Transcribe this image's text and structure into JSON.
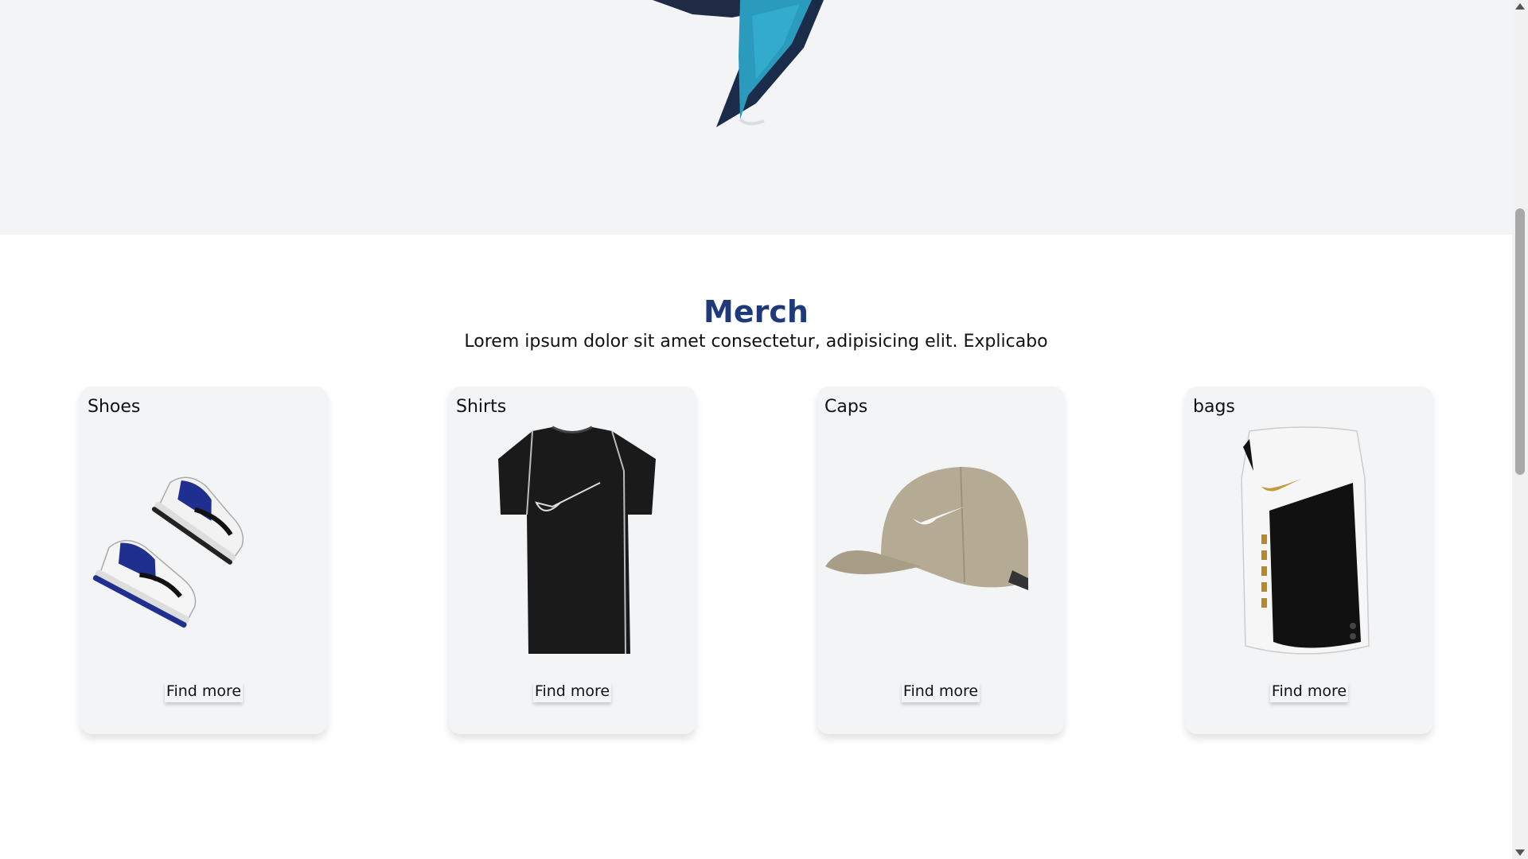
{
  "merch": {
    "title": "Merch",
    "subtitle": "Lorem ipsum dolor sit amet consectetur, adipisicing elit. Explicabo",
    "cards": [
      {
        "label": "Shoes",
        "button": "Find more",
        "icon": "sneakers-pair"
      },
      {
        "label": "Shirts",
        "button": "Find more",
        "icon": "tshirt"
      },
      {
        "label": "Caps",
        "button": "Find more",
        "icon": "cap"
      },
      {
        "label": "bags",
        "button": "Find more",
        "icon": "backpack"
      }
    ]
  },
  "colors": {
    "title": "#1e3a7b",
    "card_bg": "#f3f4f6",
    "hero_bg": "#f3f4f6",
    "accent_shoe": "#2a9bbd"
  }
}
